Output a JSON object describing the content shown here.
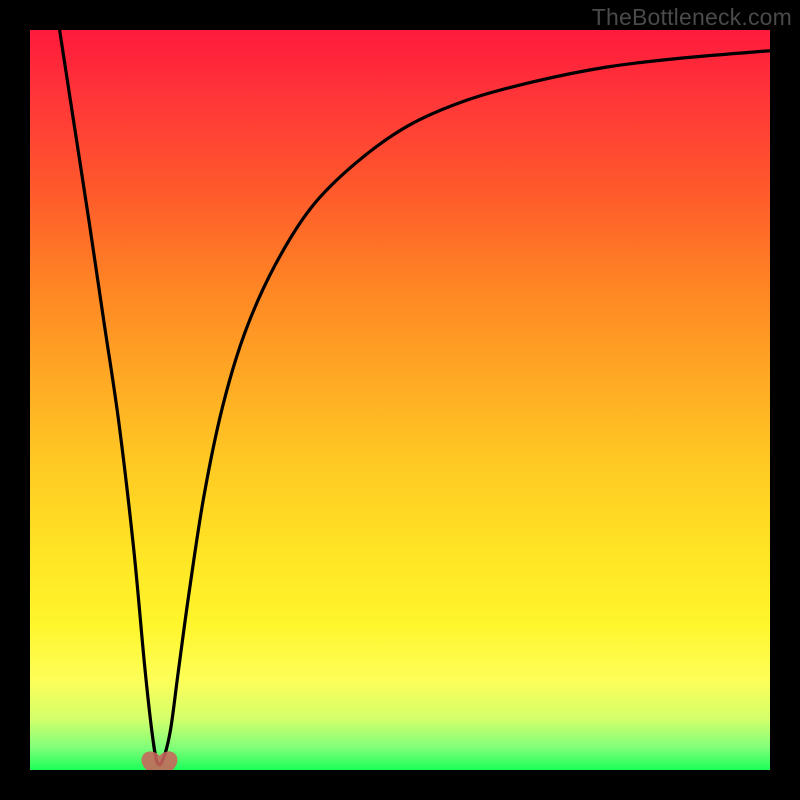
{
  "watermark": "TheBottleneck.com",
  "chart_data": {
    "type": "line",
    "title": "",
    "xlabel": "",
    "ylabel": "",
    "xlim": [
      0,
      1
    ],
    "ylim": [
      0,
      1
    ],
    "grid": false,
    "series": [
      {
        "name": "bottleneck-curve",
        "color": "#000000",
        "x": [
          0.04,
          0.06,
          0.08,
          0.1,
          0.12,
          0.14,
          0.155,
          0.165,
          0.172,
          0.18,
          0.19,
          0.2,
          0.215,
          0.235,
          0.26,
          0.29,
          0.33,
          0.38,
          0.44,
          0.51,
          0.59,
          0.68,
          0.78,
          0.88,
          1.0
        ],
        "y": [
          1.0,
          0.87,
          0.74,
          0.605,
          0.47,
          0.3,
          0.14,
          0.05,
          0.01,
          0.015,
          0.055,
          0.13,
          0.24,
          0.37,
          0.49,
          0.59,
          0.68,
          0.76,
          0.82,
          0.87,
          0.905,
          0.93,
          0.95,
          0.962,
          0.972
        ]
      }
    ],
    "markers": [
      {
        "name": "min-point-heart",
        "x": 0.175,
        "y": 0.012,
        "symbol": "heart",
        "color": "#c9655c"
      }
    ],
    "background": "gradient-red-green"
  }
}
